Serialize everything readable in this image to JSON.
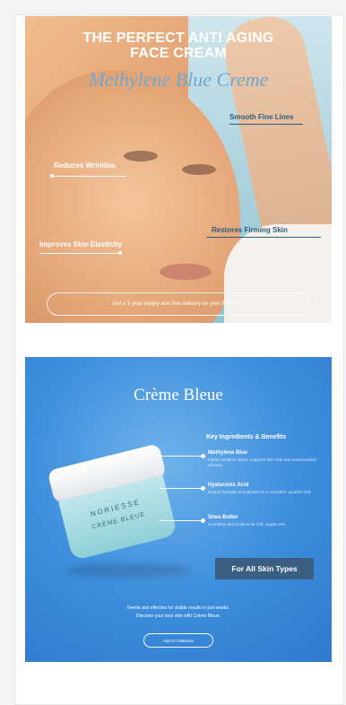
{
  "card1": {
    "headline_line1": "THE PERFECT ANTI AGING",
    "headline_line2": "FACE CREAM",
    "product_script": "Methylene Blue Creme",
    "labels": {
      "smooth": "Smooth Fine Lines",
      "wrinkles": "Reduces Wrinkles",
      "firming": "Restores Firming Skin",
      "elasticity": "Improves Skin Elasticity"
    },
    "cta": "Get a 1-year supply and free delivery on your first order"
  },
  "card2": {
    "title": "Crème Bleue",
    "jar_brand": "NORIESSE",
    "jar_sub": "CRÈME BLEUE",
    "key_label": "Key Ingredients & Benefits",
    "ingredients": [
      {
        "name": "Methylene Blue",
        "desc": "Fights oxidative stress, supports skin cells and mitochondrial renewal"
      },
      {
        "name": "Hyaluronic Acid",
        "desc": "Deeply hydrates and plumps for a smoother, youthful look"
      },
      {
        "name": "Shea Butter",
        "desc": "Nourishes and protects for soft, supple skin"
      }
    ],
    "badge": "For All Skin Types",
    "bottom_line1": "Gentle and effective for visible results in just weeks.",
    "bottom_line2": "Discover your best skin with Crème Bleue.",
    "cta": "Add to Collection"
  }
}
